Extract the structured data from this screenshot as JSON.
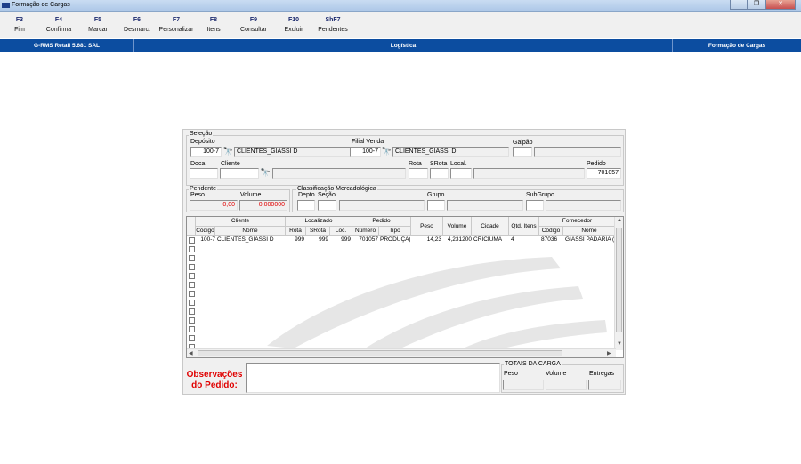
{
  "window": {
    "title": "Formação de Cargas",
    "minimize": "—",
    "restore": "❐",
    "close": "✕"
  },
  "toolbar": [
    {
      "key": "F3",
      "label": "Fim"
    },
    {
      "key": "F4",
      "label": "Confirma"
    },
    {
      "key": "F5",
      "label": "Marcar"
    },
    {
      "key": "F6",
      "label": "Desmarc."
    },
    {
      "key": "F7",
      "label": "Personalizar"
    },
    {
      "key": "F8",
      "label": "Itens"
    },
    {
      "key": "F9",
      "label": "Consultar"
    },
    {
      "key": "F10",
      "label": "Excluir"
    },
    {
      "key": "ShF7",
      "label": "Pendentes"
    }
  ],
  "status": {
    "system": "G-RMS Retail 5.681 SAL",
    "module": "Logística",
    "screen": "Formação de Cargas"
  },
  "selecao": {
    "group_label": "Seleção",
    "deposito_label": "Depósito",
    "deposito_code": "100-7",
    "deposito_name": "CLIENTES_GIASSI D",
    "filial_label": "Filial Venda",
    "filial_code": "100-7",
    "filial_name": "CLIENTES_GIASSI D",
    "galpao_label": "Galpão",
    "doca_label": "Doca",
    "cliente_label": "Cliente",
    "rota_label": "Rota",
    "srota_label": "SRota",
    "local_label": "Local.",
    "pedido_label": "Pedido",
    "pedido_value": "701057"
  },
  "pendente": {
    "group_label": "Pendente",
    "peso_label": "Peso",
    "peso_value": "0,00",
    "volume_label": "Volume",
    "volume_value": "0,000000"
  },
  "classificacao": {
    "group_label": "Classificação Mercadológica",
    "depto_label": "Depto",
    "secao_label": "Seção",
    "grupo_label": "Grupo",
    "subgrupo_label": "SubGrupo"
  },
  "grid": {
    "groups": {
      "cliente": "Cliente",
      "localizado": "Localizado",
      "pedido": "Pedido",
      "fornecedor": "Fornecedor"
    },
    "columns": {
      "codigo": "Código",
      "nome": "Nome",
      "rota": "Rota",
      "srota": "SRota",
      "loc": "Loc.",
      "numero": "Número",
      "tipo": "Tipo",
      "peso": "Peso",
      "volume": "Volume",
      "cidade": "Cidade",
      "qtd": "Qtd. Itens",
      "forn_codigo": "Código",
      "forn_nome": "Nome"
    },
    "rows": [
      {
        "codigo": "100-7",
        "nome": "CLIENTES_GIASSI D",
        "rota": "999",
        "srota": "999",
        "loc": "999",
        "numero": "701057",
        "tipo": "PRODUÇÃ(",
        "peso": "14,23",
        "volume": "4,231200",
        "cidade": "CRICIUMA",
        "qtd": "4",
        "forn_codigo": "87036",
        "forn_nome": "GIASSI PADARIA ("
      }
    ]
  },
  "observacoes": {
    "line1": "Observações",
    "line2": "do Pedido:"
  },
  "totais": {
    "group_label": "TOTAIS DA CARGA",
    "peso_label": "Peso",
    "volume_label": "Volume",
    "entregas_label": "Entregas"
  }
}
